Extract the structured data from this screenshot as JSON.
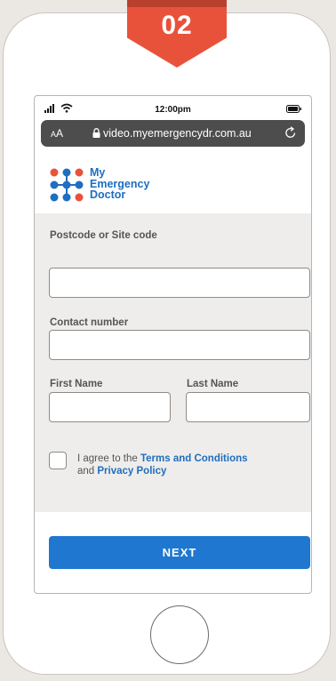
{
  "step_badge": {
    "number": "02",
    "color": "#e8523b"
  },
  "status_bar": {
    "time": "12:00pm",
    "icons": [
      "signal-icon",
      "wifi-icon",
      "battery-icon"
    ]
  },
  "browser": {
    "text_size_label": "A",
    "text_size_label_small": "A",
    "url": "video.myemergencydr.com.au",
    "icons": [
      "lock-icon",
      "reload-icon"
    ]
  },
  "logo": {
    "line1": "My",
    "line2": "Emergency",
    "line3": "Doctor",
    "brand_color": "#1f6ec0",
    "dot_color": "#e8523b"
  },
  "form": {
    "postcode_label": "Postcode or Site code",
    "postcode_value": "",
    "contact_label": "Contact number",
    "contact_value": "",
    "first_name_label": "First Name",
    "first_name_value": "",
    "last_name_label": "Last Name",
    "last_name_value": "",
    "agree_prefix": "I agree to the ",
    "terms_link": "Terms and Conditions",
    "agree_and": "and ",
    "privacy_link": "Privacy Policy",
    "agree_checked": false
  },
  "next_button": {
    "label": "NEXT",
    "color": "#1f77cf"
  }
}
